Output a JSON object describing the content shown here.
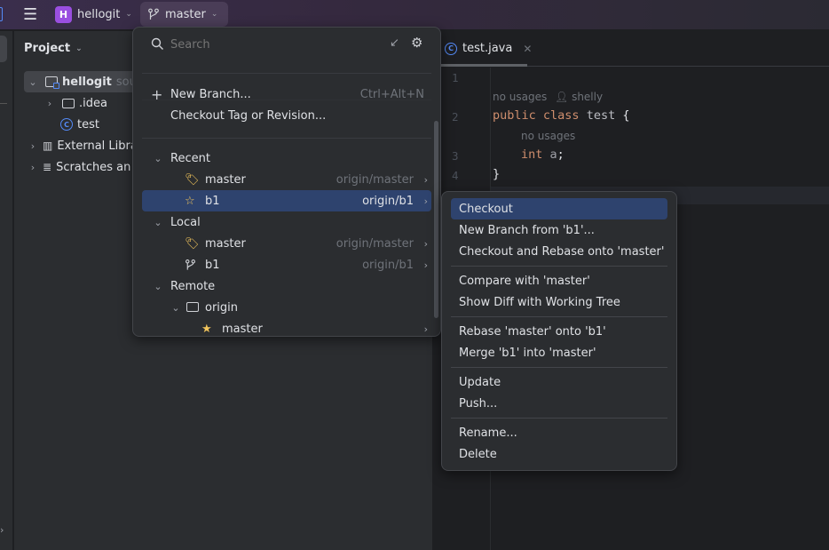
{
  "titlebar": {
    "project_initial": "H",
    "project_name": "hellogit",
    "branch": "master"
  },
  "project_panel": {
    "title": "Project",
    "tree": [
      {
        "label": "hellogit",
        "suffix": "sour",
        "icon": "module-folder-icon",
        "expanded": true
      },
      {
        "label": ".idea",
        "icon": "folder-icon",
        "expanded": false
      },
      {
        "label": "test",
        "icon": "java-class-icon"
      },
      {
        "label": "External Libra",
        "icon": "libraries-icon",
        "expanded": false
      },
      {
        "label": "Scratches an",
        "icon": "scratches-icon",
        "expanded": false
      }
    ]
  },
  "editor": {
    "tab": {
      "label": "test.java",
      "icon": "java-class-icon"
    },
    "line_numbers": [
      "1",
      "2",
      "3",
      "4"
    ],
    "hints": {
      "usages1": "no usages",
      "author": "shelly",
      "usages2": "no usages"
    },
    "code": {
      "l2_kw1": "public",
      "l2_kw2": "class",
      "l2_name": "test",
      "l2_brace": "{",
      "l3_kw": "int",
      "l3_var": "a",
      "l3_semi": ";",
      "l4": "}"
    }
  },
  "branch_popup": {
    "search_placeholder": "Search",
    "actions": [
      {
        "label": "New Branch...",
        "shortcut": "Ctrl+Alt+N"
      },
      {
        "label": "Checkout Tag or Revision..."
      }
    ],
    "groups": {
      "recent": {
        "label": "Recent",
        "items": [
          {
            "name": "master",
            "tracking": "origin/master",
            "icon": "tag-icon"
          },
          {
            "name": "b1",
            "tracking": "origin/b1",
            "icon": "star-outline-icon",
            "selected": true
          }
        ]
      },
      "local": {
        "label": "Local",
        "items": [
          {
            "name": "master",
            "tracking": "origin/master",
            "icon": "tag-icon"
          },
          {
            "name": "b1",
            "tracking": "origin/b1",
            "icon": "branch-icon"
          }
        ]
      },
      "remote": {
        "label": "Remote",
        "folder": "origin",
        "items": [
          {
            "name": "master",
            "icon": "star-icon"
          }
        ]
      }
    }
  },
  "context_menu": {
    "items": [
      "Checkout",
      "New Branch from 'b1'...",
      "Checkout and Rebase onto 'master'",
      "Compare with 'master'",
      "Show Diff with Working Tree",
      "Rebase 'master' onto 'b1'",
      "Merge 'b1' into 'master'",
      "Update",
      "Push...",
      "Rename...",
      "Delete"
    ]
  },
  "colors": {
    "accent": "#2e436e",
    "keyword": "#cf8e6d",
    "class_icon": "#548af7",
    "tag": "#f2c55c",
    "project_badge": "#9a4fe0"
  }
}
